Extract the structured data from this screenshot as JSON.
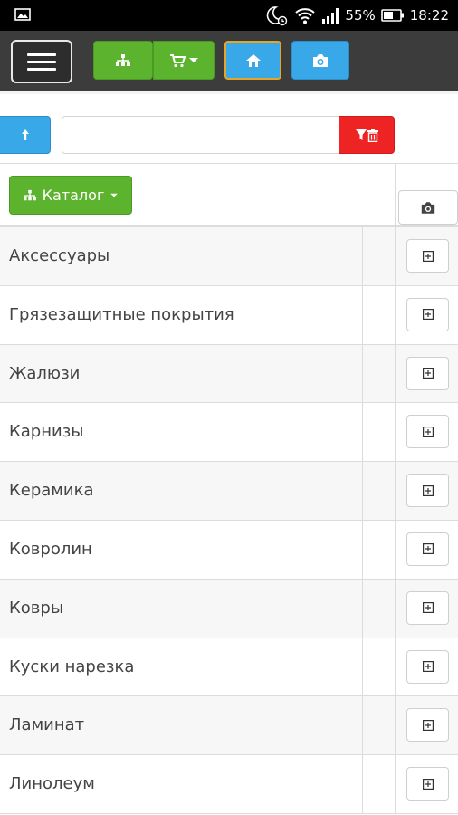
{
  "status_bar": {
    "battery_percent": "55%",
    "time": "18:22",
    "icons": [
      "image-icon",
      "moon-alarm-icon",
      "wifi-icon",
      "signal-icon",
      "battery-icon"
    ]
  },
  "toolbar": {
    "buttons": [
      "menu-icon",
      "sitemap-icon",
      "cart-icon",
      "home-icon",
      "camera-icon"
    ],
    "colors": {
      "green": "#5cb42e",
      "blue": "#39a8e8",
      "active_border": "#e3a52a",
      "dark": "#3c3c3c"
    }
  },
  "filter": {
    "search_value": "",
    "search_placeholder": "",
    "clear_color": "#ee2424"
  },
  "catalog": {
    "button_label": "Каталог",
    "rows": [
      {
        "name": "Аксессуары"
      },
      {
        "name": "Грязезащитные покрытия"
      },
      {
        "name": "Жалюзи"
      },
      {
        "name": "Карнизы"
      },
      {
        "name": "Керамика"
      },
      {
        "name": "Ковролин"
      },
      {
        "name": "Ковры"
      },
      {
        "name": "Куски нарезка"
      },
      {
        "name": "Ламинат"
      },
      {
        "name": "Линолеум"
      }
    ]
  }
}
